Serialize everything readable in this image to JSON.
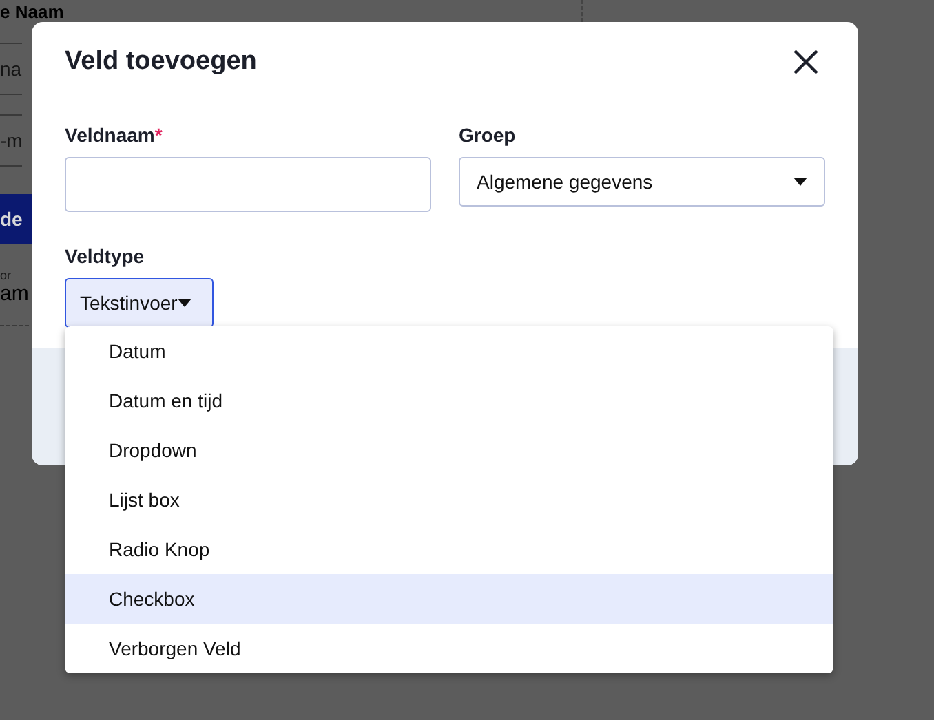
{
  "background": {
    "header": "e Naam",
    "field_1": "na",
    "field_2": "-m",
    "button": "de",
    "caption": "or",
    "value": "am"
  },
  "dialog": {
    "title": "Veld toevoegen",
    "name_field": {
      "label": "Veldnaam",
      "required_mark": "*"
    },
    "group_field": {
      "label": "Groep",
      "value": "Algemene gegevens"
    },
    "type_field": {
      "label": "Veldtype",
      "value": "Tekstinvoer",
      "expanded": true
    },
    "options": [
      {
        "label": "Datum",
        "selected": false
      },
      {
        "label": "Datum en tijd",
        "selected": false
      },
      {
        "label": "Dropdown",
        "selected": false
      },
      {
        "label": "Lijst box",
        "selected": false
      },
      {
        "label": "Radio Knop",
        "selected": false
      },
      {
        "label": "Checkbox",
        "selected": true
      },
      {
        "label": "Verborgen Veld",
        "selected": false
      }
    ]
  }
}
